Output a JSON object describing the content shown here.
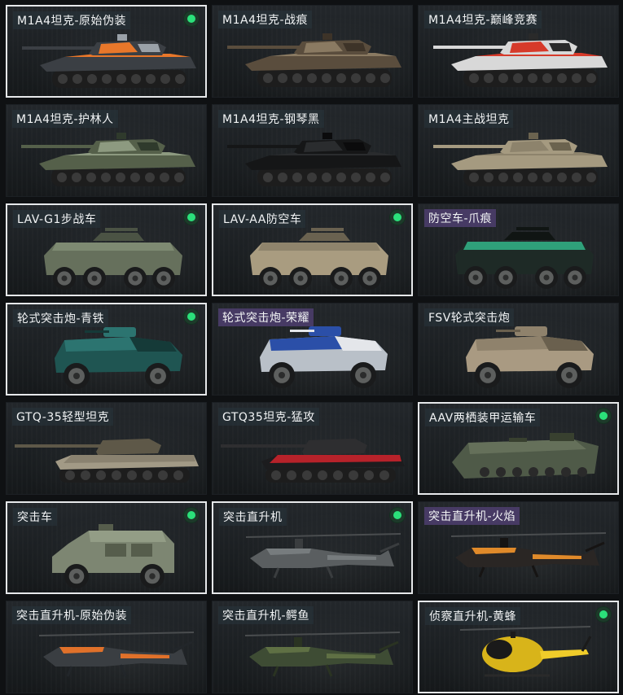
{
  "vehicles": [
    {
      "label": "M1A4坦克-原始伪装",
      "type": "tank",
      "camo": [
        "#3b3f44",
        "#e8772a",
        "#9aa1a8"
      ],
      "selected": true,
      "owned": true,
      "tag": "plain"
    },
    {
      "label": "M1A4坦克-战痕",
      "type": "tank",
      "camo": [
        "#5a4d3d",
        "#8a7a62",
        "#3d3328"
      ],
      "selected": false,
      "owned": false,
      "tag": "plain"
    },
    {
      "label": "M1A4坦克-巅峰竞赛",
      "type": "tank",
      "camo": [
        "#d8d8d8",
        "#d63a2a",
        "#2a2a2a"
      ],
      "selected": false,
      "owned": false,
      "tag": "plain"
    },
    {
      "label": "M1A4坦克-护林人",
      "type": "tank",
      "camo": [
        "#55604a",
        "#8d9a80",
        "#2f3a2c"
      ],
      "selected": false,
      "owned": false,
      "tag": "plain"
    },
    {
      "label": "M1A4坦克-钢琴黑",
      "type": "tank",
      "camo": [
        "#151617",
        "#2a2c2e",
        "#0b0b0c"
      ],
      "selected": false,
      "owned": false,
      "tag": "plain"
    },
    {
      "label": "M1A4主战坦克",
      "type": "tank",
      "camo": [
        "#a59a80",
        "#8d836c",
        "#6b634f"
      ],
      "selected": false,
      "owned": false,
      "tag": "plain"
    },
    {
      "label": "LAV-G1步战车",
      "type": "ifv",
      "camo": [
        "#66705c",
        "#7e8a72",
        "#4b5344"
      ],
      "selected": true,
      "owned": true,
      "tag": "plain"
    },
    {
      "label": "LAV-AA防空车",
      "type": "ifv",
      "camo": [
        "#a99c80",
        "#8f846c",
        "#6a6250"
      ],
      "selected": true,
      "owned": true,
      "tag": "plain"
    },
    {
      "label": "防空车-爪痕",
      "type": "ifv",
      "camo": [
        "#1e2a26",
        "#2fa07a",
        "#101513"
      ],
      "selected": false,
      "owned": false,
      "tag": "purple"
    },
    {
      "label": "轮式突击炮-青铁",
      "type": "armored",
      "camo": [
        "#1f5552",
        "#2c7470",
        "#153a38"
      ],
      "selected": true,
      "owned": true,
      "tag": "plain"
    },
    {
      "label": "轮式突击炮-荣耀",
      "type": "armored",
      "camo": [
        "#b9c0c8",
        "#2b4fa8",
        "#e4e6ea"
      ],
      "selected": false,
      "owned": false,
      "tag": "purple"
    },
    {
      "label": "FSV轮式突击炮",
      "type": "armored",
      "camo": [
        "#a99a82",
        "#8f826c",
        "#6a604e"
      ],
      "selected": false,
      "owned": false,
      "tag": "plain"
    },
    {
      "label": "GTQ-35轻型坦克",
      "type": "light",
      "camo": [
        "#a29a86",
        "#8a8270",
        "#5e5848"
      ],
      "selected": false,
      "owned": false,
      "tag": "plain"
    },
    {
      "label": "GTQ35坦克-猛攻",
      "type": "light",
      "camo": [
        "#1c1c1e",
        "#b7222a",
        "#2e2e30"
      ],
      "selected": false,
      "owned": false,
      "tag": "plain"
    },
    {
      "label": "AAV两栖装甲运输车",
      "type": "amphib",
      "camo": [
        "#4f5a48",
        "#65705a",
        "#38402f"
      ],
      "selected": true,
      "owned": true,
      "tag": "plain"
    },
    {
      "label": "突击车",
      "type": "truck",
      "camo": [
        "#7d8672",
        "#939d86",
        "#565d4c"
      ],
      "selected": true,
      "owned": true,
      "tag": "plain"
    },
    {
      "label": "突击直升机",
      "type": "heli",
      "camo": [
        "#5a5e60",
        "#777c7e",
        "#3a3d3f"
      ],
      "selected": true,
      "owned": true,
      "tag": "plain"
    },
    {
      "label": "突击直升机-火焰",
      "type": "heli",
      "camo": [
        "#2a2624",
        "#e08a2a",
        "#161413"
      ],
      "selected": false,
      "owned": false,
      "tag": "purple"
    },
    {
      "label": "突击直升机-原始伪装",
      "type": "heli",
      "camo": [
        "#3a3e42",
        "#e0712a",
        "#22262a"
      ],
      "selected": false,
      "owned": false,
      "tag": "plain"
    },
    {
      "label": "突击直升机-鳄鱼",
      "type": "heli",
      "camo": [
        "#3e4c34",
        "#5f7044",
        "#2a3322"
      ],
      "selected": false,
      "owned": false,
      "tag": "plain"
    },
    {
      "label": "侦察直升机-黄蜂",
      "type": "scout",
      "camo": [
        "#d8b41a",
        "#1a1a1a",
        "#f0cc2a"
      ],
      "selected": true,
      "owned": true,
      "tag": "plain"
    }
  ],
  "colors": {
    "owned_indicator": "#2be07a",
    "selected_border": "#e6e8ea",
    "tag_purple": "#4e3e6e",
    "background": "#0f1113"
  }
}
